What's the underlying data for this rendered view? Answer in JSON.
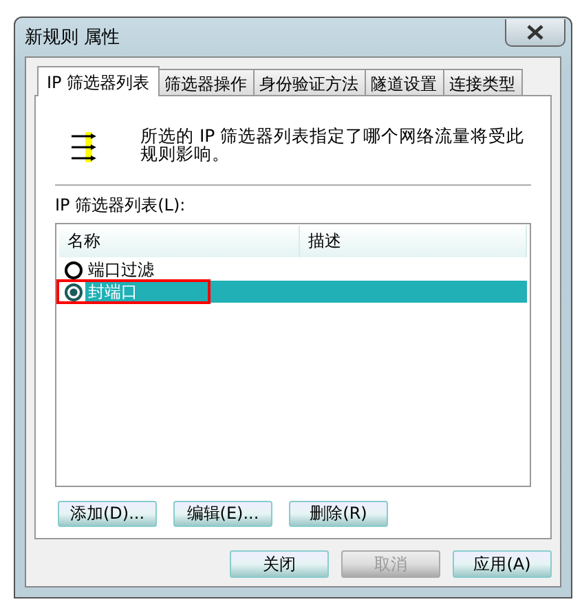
{
  "window": {
    "title": "新规则 属性"
  },
  "tabs": [
    {
      "label": "IP 筛选器列表",
      "selected": true
    },
    {
      "label": "筛选器操作",
      "selected": false
    },
    {
      "label": "身份验证方法",
      "selected": false
    },
    {
      "label": "隧道设置",
      "selected": false
    },
    {
      "label": "连接类型",
      "selected": false
    }
  ],
  "description": "所选的 IP 筛选器列表指定了哪个网络流量将受此规则影响。",
  "list_label": "IP 筛选器列表(L):",
  "table": {
    "columns": [
      "名称",
      "描述"
    ],
    "rows": [
      {
        "name": "端口过滤",
        "selected": false,
        "highlighted": false
      },
      {
        "name": "封端口",
        "selected": true,
        "highlighted": true
      }
    ]
  },
  "list_buttons": [
    {
      "label": "添加(D)..."
    },
    {
      "label": "编辑(E)..."
    },
    {
      "label": "删除(R)"
    }
  ],
  "dialog_buttons": [
    {
      "label": "关闭",
      "disabled": false
    },
    {
      "label": "取消",
      "disabled": true
    },
    {
      "label": "应用(A)",
      "disabled": false
    }
  ]
}
